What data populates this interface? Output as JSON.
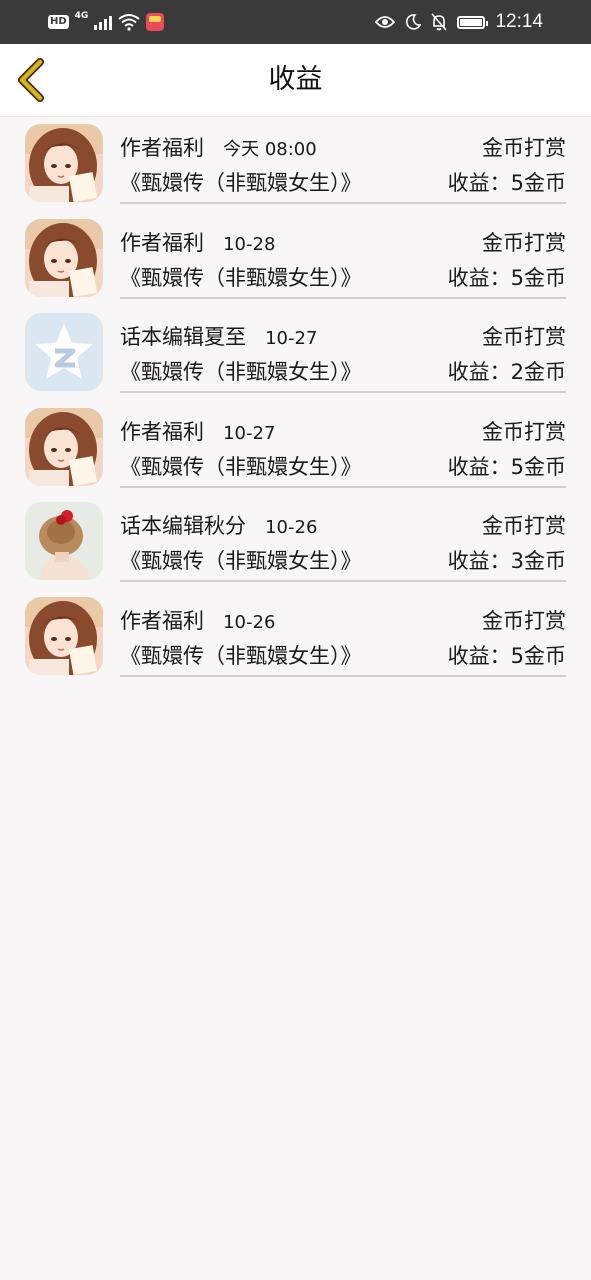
{
  "status_bar": {
    "hd": "HD",
    "network": "4G",
    "time": "12:14"
  },
  "header": {
    "title": "收益"
  },
  "items": [
    {
      "sender": "作者福利",
      "date": "今天 08:00",
      "type": "金币打赏",
      "book": "《甄嬛传（非甄嬛女生）》",
      "income": "收益：5金币",
      "avatar": "anime-girl"
    },
    {
      "sender": "作者福利",
      "date": "10-28",
      "type": "金币打赏",
      "book": "《甄嬛传（非甄嬛女生）》",
      "income": "收益：5金币",
      "avatar": "anime-girl"
    },
    {
      "sender": "话本编辑夏至",
      "date": "10-27",
      "type": "金币打赏",
      "book": "《甄嬛传（非甄嬛女生）》",
      "income": "收益：2金币",
      "avatar": "star-logo"
    },
    {
      "sender": "作者福利",
      "date": "10-27",
      "type": "金币打赏",
      "book": "《甄嬛传（非甄嬛女生）》",
      "income": "收益：5金币",
      "avatar": "anime-girl"
    },
    {
      "sender": "话本编辑秋分",
      "date": "10-26",
      "type": "金币打赏",
      "book": "《甄嬛传（非甄嬛女生）》",
      "income": "收益：3金币",
      "avatar": "hair-bun-photo"
    },
    {
      "sender": "作者福利",
      "date": "10-26",
      "type": "金币打赏",
      "book": "《甄嬛传（非甄嬛女生）》",
      "income": "收益：5金币",
      "avatar": "anime-girl"
    }
  ],
  "colors": {
    "back_arrow": "#d8b21c",
    "background": "#f8f6f7",
    "header_bg": "#ffffff",
    "status_bar_bg": "#3a3a3a"
  }
}
